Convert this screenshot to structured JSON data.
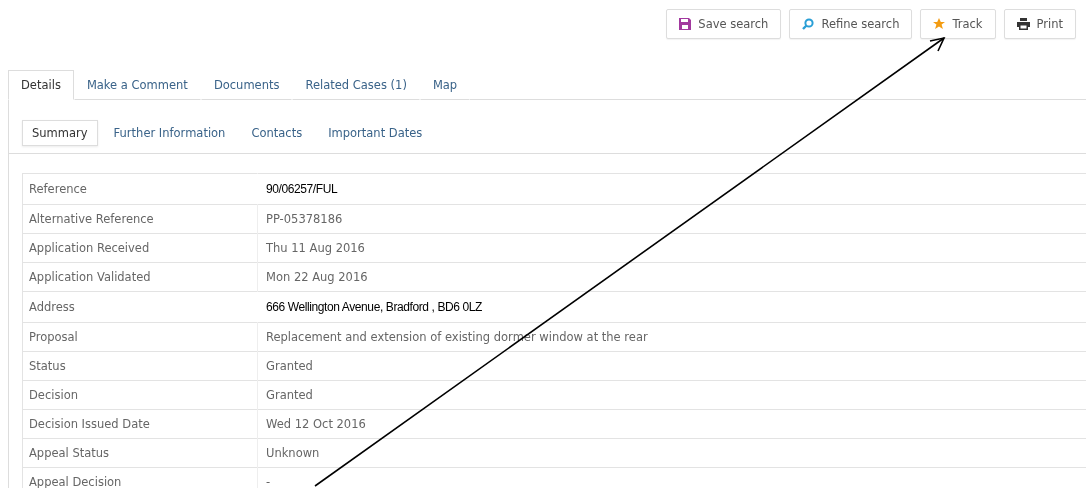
{
  "toolbar": [
    {
      "label": "Save search",
      "kind": "save"
    },
    {
      "label": "Refine search",
      "kind": "search"
    },
    {
      "label": "Track",
      "kind": "star"
    },
    {
      "label": "Print",
      "kind": "print"
    }
  ],
  "tabs": [
    {
      "label": "Details",
      "selected": true
    },
    {
      "label": "Make a Comment",
      "selected": false
    },
    {
      "label": "Documents",
      "selected": false
    },
    {
      "label": "Related Cases (1)",
      "selected": false
    },
    {
      "label": "Map",
      "selected": false
    }
  ],
  "subtabs": [
    {
      "label": "Summary",
      "selected": true
    },
    {
      "label": "Further Information",
      "selected": false
    },
    {
      "label": "Contacts",
      "selected": false
    },
    {
      "label": "Important Dates",
      "selected": false
    }
  ],
  "table": {
    "rows": [
      {
        "label": "Reference",
        "value": "90/06257/FUL",
        "kind": "pasted"
      },
      {
        "label": "Alternative Reference",
        "value": "PP-05378186",
        "kind": "plain"
      },
      {
        "label": "Application Received",
        "value": "Thu 11 Aug 2016",
        "kind": "plain"
      },
      {
        "label": "Application Validated",
        "value": "Mon 22 Aug 2016",
        "kind": "plain"
      },
      {
        "label": "Address",
        "value": "666 Wellington Avenue, Bradford , BD6 0LZ",
        "kind": "pasted"
      },
      {
        "label": "Proposal",
        "value": "Replacement and extension of existing dormer window at the rear",
        "kind": "plain"
      },
      {
        "label": "Status",
        "value": "Granted",
        "kind": "plain"
      },
      {
        "label": "Decision",
        "value": "Granted",
        "kind": "plain"
      },
      {
        "label": "Decision Issued Date",
        "value": "Wed 12 Oct 2016",
        "kind": "plain"
      },
      {
        "label": "Appeal Status",
        "value": "Unknown",
        "kind": "plain"
      },
      {
        "label": "Appeal Decision",
        "value": "-",
        "kind": "plain"
      }
    ]
  },
  "annotation": {
    "kind": "arrow"
  }
}
